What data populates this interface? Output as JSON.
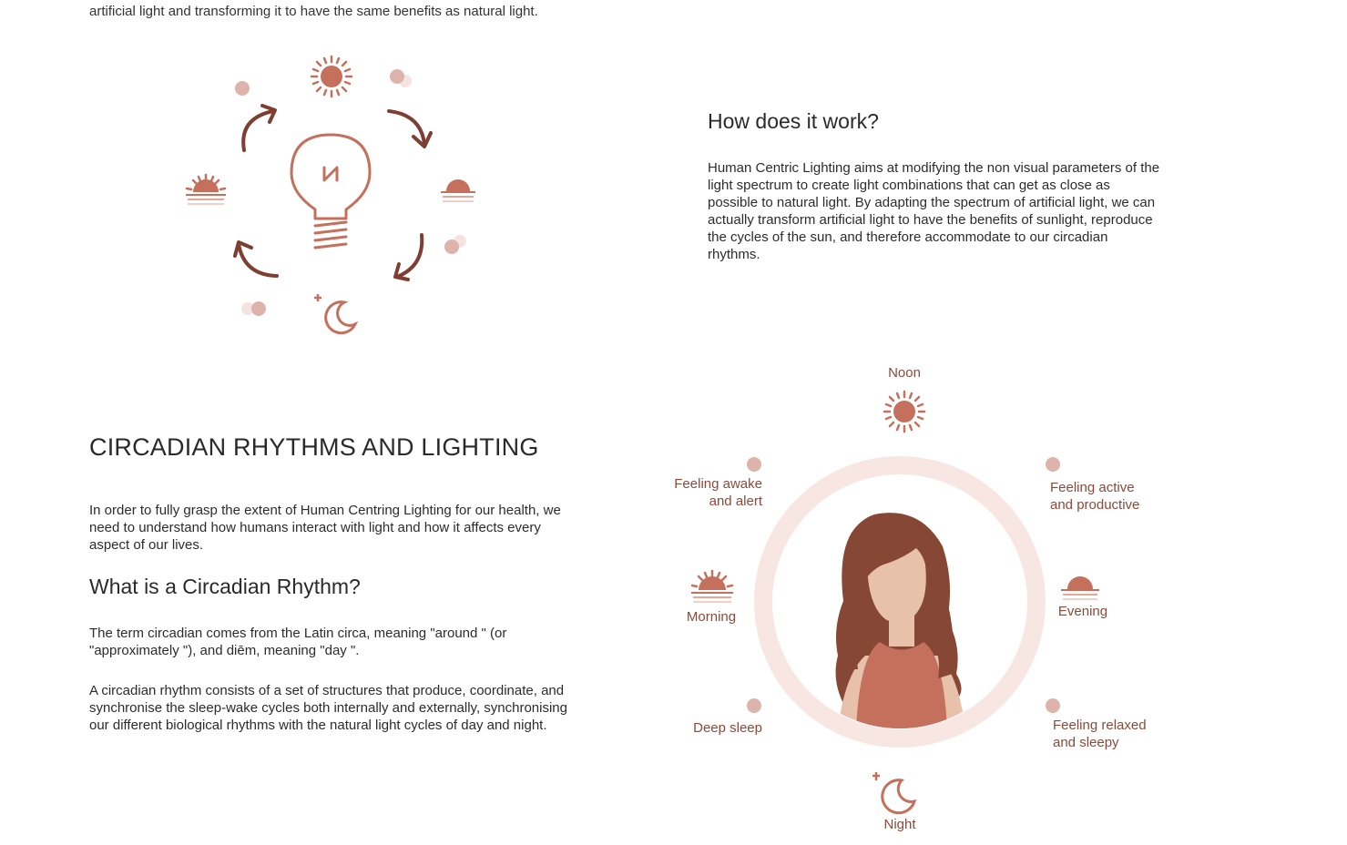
{
  "intro": {
    "clipped_line": "artificial light and transforming it to have the same benefits as natural light."
  },
  "how": {
    "title": "How does it work?",
    "body": "Human Centric Lighting aims at modifying the non visual parameters of the light spectrum to create light combinations that can get as close as possible to natural light. By adapting the spectrum of artificial light, we can actually transform artificial light to have the benefits of sunlight, reproduce the cycles of the sun, and therefore accommodate to our circadian rhythms."
  },
  "circadian": {
    "title": "CIRCADIAN RHYTHMS AND LIGHTING",
    "intro": "In order to fully grasp the extent of Human Centring Lighting for our health, we need to understand how humans interact with light and how it affects every aspect of our lives.",
    "what_title": "What is a Circadian Rhythm?",
    "what_p1": "The term circadian comes from the Latin circa, meaning \"around \" (or \"approximately \"), and diēm, meaning \"day \".",
    "what_p2": "A circadian rhythm consists of a set of structures that produce, coordinate, and synchronise the sleep-wake cycles both internally and externally, synchronising our different biological rhythms with the natural light cycles of day and night."
  },
  "cycle": {
    "noon": "Noon",
    "awake": "Feeling awake and alert",
    "active": "Feeling active and productive",
    "morning": "Morning",
    "evening": "Evening",
    "deep_sleep": "Deep sleep",
    "relaxed": "Feeling relaxed and sleepy",
    "night": "Night"
  },
  "colors": {
    "accent": "#c4705c",
    "dark_accent": "#7e3f32",
    "soft": "#ddb3ab",
    "ring": "#f8e6e2",
    "hair": "#874735",
    "skin": "#e8c1ab"
  },
  "icons": [
    "sun-icon",
    "sunrise-icon",
    "sunset-icon",
    "moon-icon",
    "lightbulb-icon",
    "cycle-arrow-icon",
    "dot-icon"
  ]
}
